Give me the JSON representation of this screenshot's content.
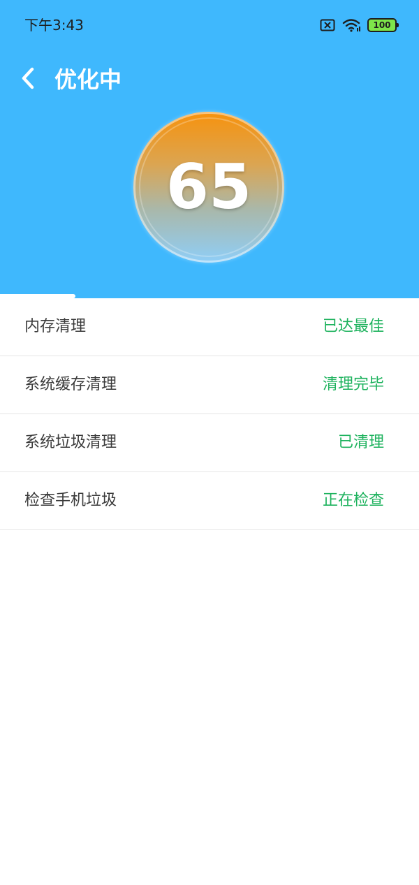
{
  "status_bar": {
    "time": "下午3:43",
    "battery_level": "100",
    "icons": [
      "sim-off-icon",
      "wifi-icon",
      "battery-icon"
    ]
  },
  "header": {
    "title": "优化中",
    "back_icon": "chevron-left-icon",
    "score": "65",
    "progress": 0.18
  },
  "tasks": [
    {
      "name": "内存清理",
      "status": "已达最佳"
    },
    {
      "name": "系统缓存清理",
      "status": "清理完毕"
    },
    {
      "name": "系统垃圾清理",
      "status": "已清理"
    },
    {
      "name": "检查手机垃圾",
      "status": "正在检查"
    }
  ],
  "colors": {
    "header_bg": "#3fb8fd",
    "status_green": "#1db25d",
    "ball_top": "#f7920d",
    "ball_bottom": "#8fcef7"
  }
}
